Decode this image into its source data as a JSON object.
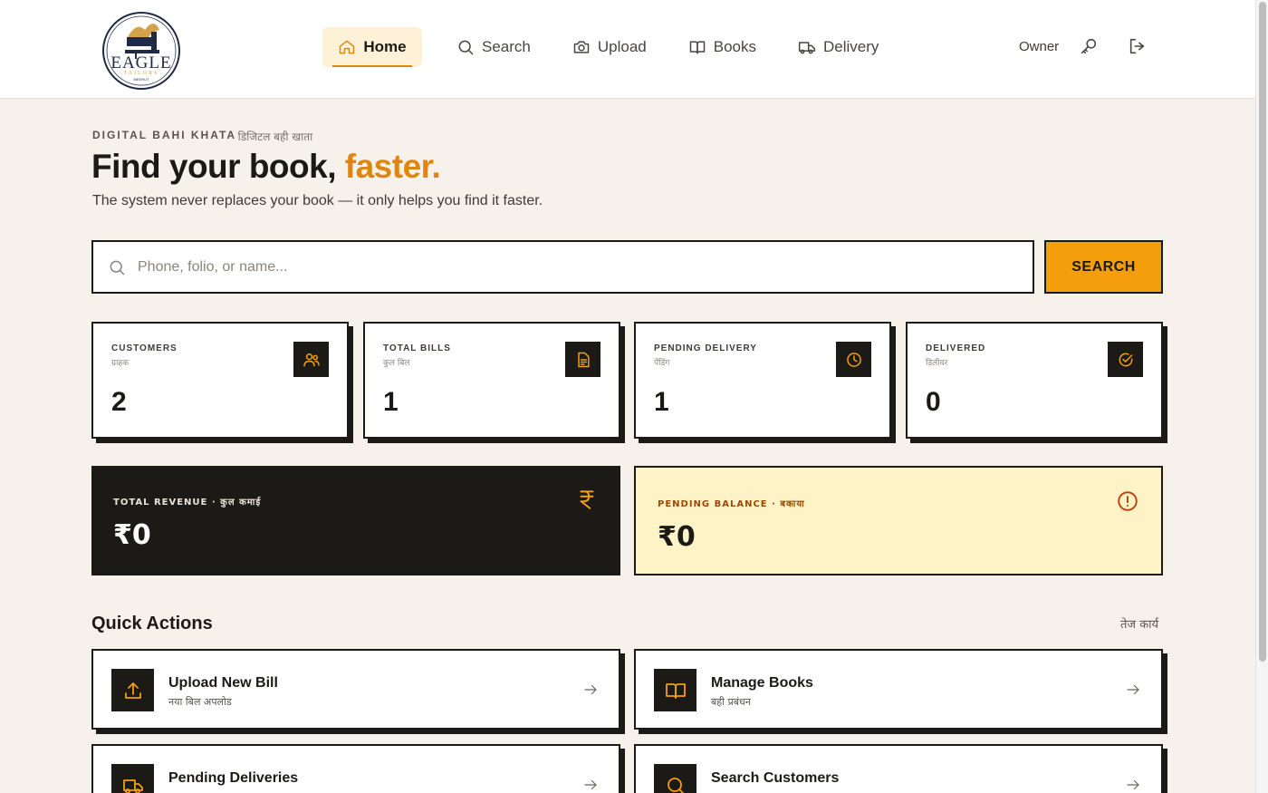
{
  "brand": {
    "logo_icon": "eagle-tailors-logo",
    "name": "EAGLE",
    "tagline": "TAILORS",
    "location": "MEERUT"
  },
  "nav": {
    "items": [
      {
        "label": "Home",
        "icon": "home-icon",
        "active": true
      },
      {
        "label": "Search",
        "icon": "search-icon",
        "active": false
      },
      {
        "label": "Upload",
        "icon": "camera-icon",
        "active": false
      },
      {
        "label": "Books",
        "icon": "book-icon",
        "active": false
      },
      {
        "label": "Delivery",
        "icon": "truck-icon",
        "active": false
      }
    ]
  },
  "header_tools": {
    "user_label": "Owner",
    "key_icon": "key-icon",
    "logout_icon": "logout-icon"
  },
  "hero": {
    "eyebrow": "DIGITAL BAHI KHATA",
    "eyebrow_hindi": "· डिजिटल बही खाता",
    "headline_main": "Find your book,",
    "headline_accent": "faster.",
    "subline": "The system never replaces your book — it only helps you find it faster."
  },
  "search": {
    "placeholder": "Phone, folio, or name...",
    "value": "",
    "button_label": "SEARCH"
  },
  "stats": [
    {
      "label": "CUSTOMERS",
      "label_hindi": "ग्राहक",
      "value": "2",
      "icon": "users-icon"
    },
    {
      "label": "TOTAL BILLS",
      "label_hindi": "कुल बिल",
      "value": "1",
      "icon": "document-icon"
    },
    {
      "label": "PENDING DELIVERY",
      "label_hindi": "पेंडिंग",
      "value": "1",
      "icon": "clock-icon"
    },
    {
      "label": "DELIVERED",
      "label_hindi": "डिलीवर",
      "value": "0",
      "icon": "check-circle-icon"
    }
  ],
  "revenue": {
    "label": "TOTAL REVENUE · कुल कमाई",
    "value": "₹0",
    "icon": "rupee-icon"
  },
  "balance": {
    "label": "PENDING BALANCE · बकाया",
    "value": "₹0",
    "icon": "alert-circle-icon"
  },
  "quick_actions": {
    "title": "Quick Actions",
    "title_hindi": "तेज कार्य",
    "items": [
      {
        "title": "Upload New Bill",
        "subtitle": "नया बिल अपलोड",
        "icon": "upload-icon"
      },
      {
        "title": "Manage Books",
        "subtitle": "बही प्रबंधन",
        "icon": "book-open-icon"
      },
      {
        "title": "Pending Deliveries",
        "subtitle": "",
        "icon": "truck-icon"
      },
      {
        "title": "Search Customers",
        "subtitle": "",
        "icon": "search-icon"
      }
    ]
  },
  "colors": {
    "accent": "#e0860f",
    "button": "#f59e0b",
    "ink": "#1c1a17",
    "background": "#f6f1ea",
    "balance_bg": "#fef3c7"
  }
}
